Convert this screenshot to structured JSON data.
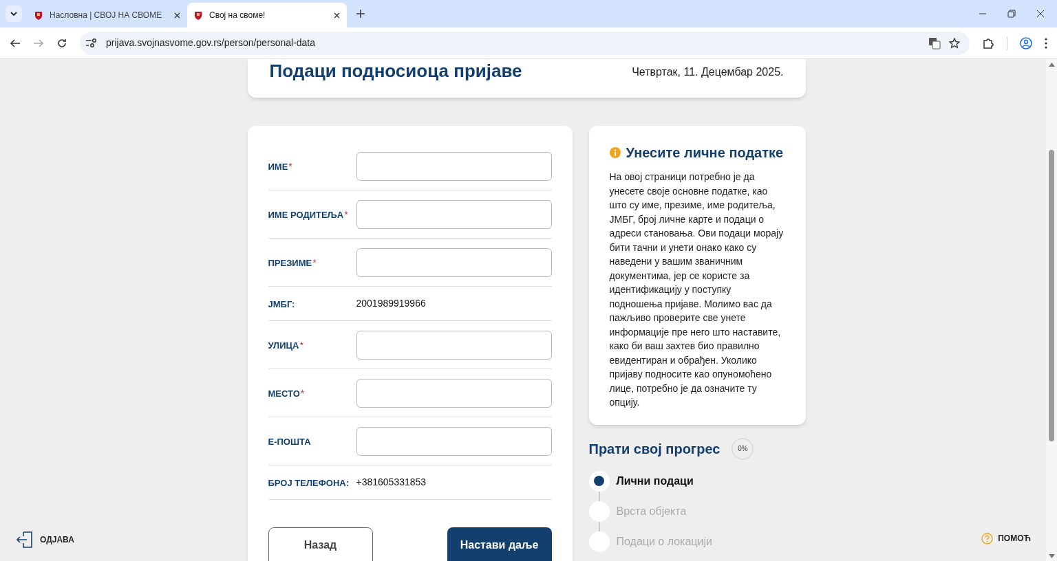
{
  "browser": {
    "tabs": [
      {
        "title": "Насловна | СВОЈ НА СВОМЕ",
        "selected": false
      },
      {
        "title": "Свој на своме!",
        "selected": true
      }
    ],
    "url": "prijava.svojnasvome.gov.rs/person/personal-data"
  },
  "header": {
    "title": "Подаци подносиоца пријаве",
    "date": "Четвртак, 11. Децембар 2025."
  },
  "form": {
    "fields": [
      {
        "label": "ИМЕ",
        "kind": "input",
        "required": true
      },
      {
        "label": "ИМЕ РОДИТЕЉА",
        "kind": "input",
        "required": true
      },
      {
        "label": "ПРЕЗИМЕ",
        "kind": "input",
        "required": true
      },
      {
        "label": "ЈМБГ:",
        "kind": "value",
        "value": "2001989919966"
      },
      {
        "label": "УЛИЦА",
        "kind": "input",
        "required": true
      },
      {
        "label": "МЕСТО",
        "kind": "input",
        "required": true
      },
      {
        "label": "Е-ПОШТА",
        "kind": "input",
        "required": false
      },
      {
        "label": "БРОЈ ТЕЛЕФОНА:",
        "kind": "value",
        "value": "+381605331853"
      }
    ],
    "required_mark": "*",
    "buttons": [
      {
        "label": "Назад",
        "kind": "secondary"
      },
      {
        "label": "Настави даље",
        "kind": "primary"
      }
    ]
  },
  "info": {
    "title": "Унесите личне податке",
    "text": "На овој страници потребно је да унесете своје основне податке, као што су име, презиме, име родитеља, ЈМБГ, број личне карте и подаци о адреси становања. Ови подаци морају бити тачни и унети онако како су наведени у вашим званичним документима, јер се користе за идентификацију у поступку подношења пријаве. Молимо вас да пажљиво проверите све унете информације пре него што наставите, како би ваш захтев био правилно евидентиран и обрађен. Уколико пријаву подносите као опуномоћено лице, потребно је да означите ту опцију."
  },
  "progress": {
    "title": "Прати свој прогрес",
    "reading": "0%",
    "level": 0,
    "steps": [
      {
        "label": "Лични подаци",
        "selected": true
      },
      {
        "label": "Врста објекта",
        "selected": false
      },
      {
        "label": "Подаци о локацији",
        "selected": false
      }
    ]
  },
  "logout": "ОДЈАВА",
  "help": "ПОМОЋ"
}
